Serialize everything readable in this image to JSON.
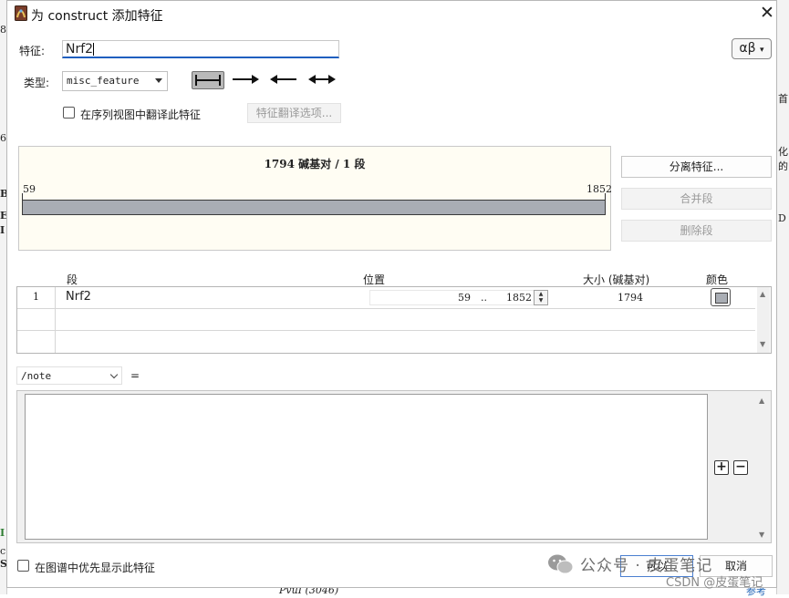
{
  "window": {
    "title": "为 construct 添加特征",
    "close_glyph": "✕"
  },
  "feature": {
    "name_label": "特征:",
    "name_value": "Nrf2",
    "alphabet_button": "αβ",
    "type_label": "类型:",
    "type_value": "misc_feature",
    "translate_checkbox_label": "在序列视图中翻译此特征",
    "translate_checked": false,
    "translate_options_button": "特征翻译选项...",
    "directions": [
      "none",
      "forward",
      "reverse",
      "both"
    ],
    "selected_direction": "none"
  },
  "map": {
    "summary": "1794 碱基对 / 1 段",
    "start": "59",
    "end": "1852",
    "bar_color": "#a9adb4"
  },
  "actions": {
    "split": "分离特征...",
    "merge": "合并段",
    "delete": "删除段"
  },
  "segments": {
    "headers": {
      "segment": "段",
      "position": "位置",
      "size": "大小 (碱基对)",
      "color": "颜色"
    },
    "rows": [
      {
        "index": "1",
        "name": "Nrf2",
        "start": "59",
        "sep": "..",
        "end": "1852",
        "size": "1794",
        "color": "#a9adb4"
      }
    ]
  },
  "qualifier": {
    "key": "/note",
    "equals": "=",
    "value": ""
  },
  "footer": {
    "prioritize_label": "在图谱中优先显示此特征",
    "prioritize_checked": false,
    "ok_button": "可以",
    "cancel_button": "取消"
  },
  "watermark": {
    "wechat": "公众号 · 皮蛋笔记",
    "csdn": "CSDN @皮蛋笔记"
  },
  "background_fragments": {
    "left": [
      "8",
      "6",
      "Be",
      "EI",
      "I",
      "I",
      "c",
      "S"
    ],
    "right": [
      "首",
      "化",
      "的",
      "D",
      "参考"
    ],
    "bottom": "PvuI (3046)"
  }
}
